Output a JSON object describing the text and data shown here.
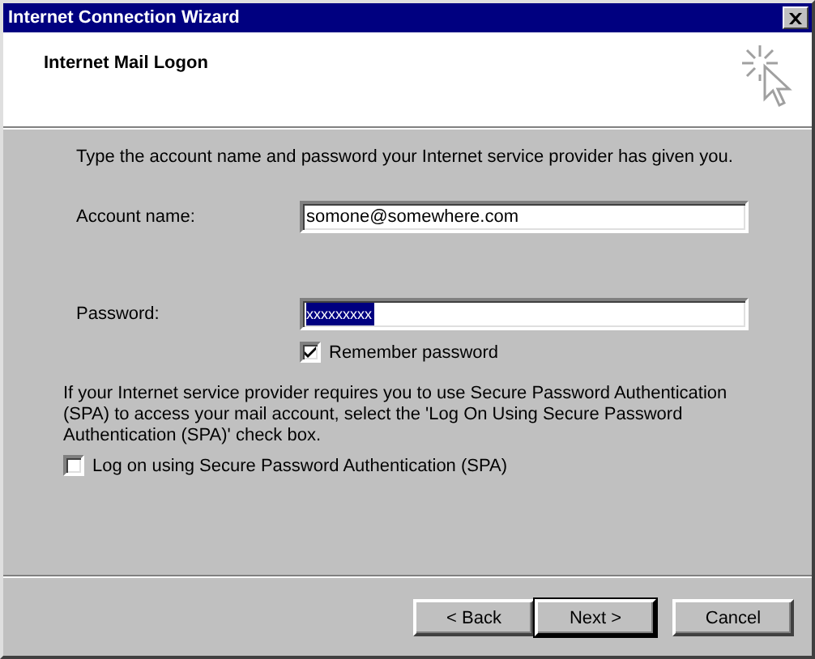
{
  "window": {
    "title": "Internet Connection Wizard"
  },
  "header": {
    "title": "Internet Mail Logon"
  },
  "intro": "Type the account name and password your Internet service provider has given you.",
  "fields": [
    {
      "label": "Account name:",
      "value": "somone@somewhere.com",
      "text_selected": false
    },
    {
      "label": "Password:",
      "value": "xxxxxxxxx",
      "text_selected": true
    }
  ],
  "remember_password": {
    "label": "Remember password",
    "checked": true
  },
  "spa_note": "If your Internet service provider requires you to use Secure Password Authentication (SPA) to access your mail account, select the 'Log On Using Secure Password Authentication (SPA)' check box.",
  "spa_option": {
    "label": "Log on using Secure Password Authentication (SPA)",
    "checked": false
  },
  "buttons": [
    {
      "label": "< Back",
      "default": false
    },
    {
      "label": "Next >",
      "default": true
    },
    {
      "label": "Cancel",
      "default": false
    }
  ]
}
